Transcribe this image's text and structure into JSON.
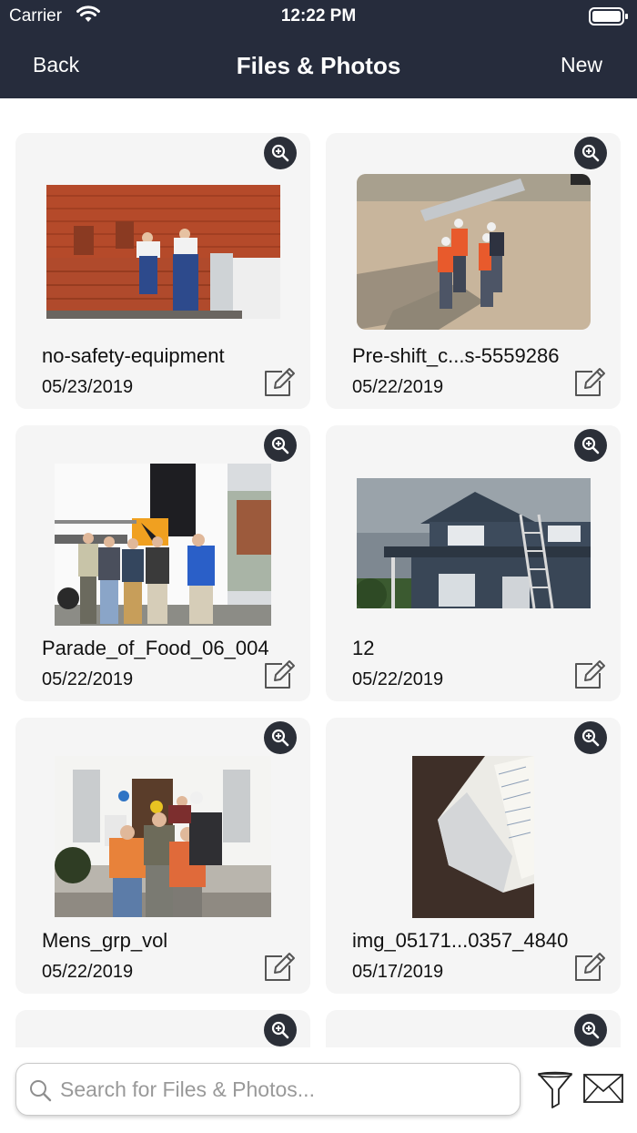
{
  "status_bar": {
    "carrier": "Carrier",
    "time": "12:22 PM"
  },
  "nav": {
    "back": "Back",
    "title": "Files & Photos",
    "new": "New"
  },
  "files": [
    {
      "title": "no-safety-equipment",
      "date": "05/23/2019",
      "thumb": "roof workers"
    },
    {
      "title": "Pre-shift_c...s-5559286",
      "date": "05/22/2019",
      "thumb": "site workers"
    },
    {
      "title": "Parade_of_Food_06_004",
      "date": "05/22/2019",
      "thumb": "group in front of truck"
    },
    {
      "title": "12",
      "date": "05/22/2019",
      "thumb": "house"
    },
    {
      "title": "Mens_grp_vol",
      "date": "05/22/2019",
      "thumb": "group on steps"
    },
    {
      "title": "img_05171...0357_4840",
      "date": "05/17/2019",
      "thumb": "notebook"
    }
  ],
  "search": {
    "placeholder": "Search for Files & Photos...",
    "value": ""
  },
  "icons": {
    "zoom": "zoom-in-icon",
    "edit": "edit-icon",
    "search": "search-icon",
    "filter": "filter-icon",
    "mail": "mail-icon"
  },
  "colors": {
    "nav_bg": "#262c3c",
    "card_bg": "#f5f5f5",
    "zoom_bg": "#2b2f38"
  }
}
